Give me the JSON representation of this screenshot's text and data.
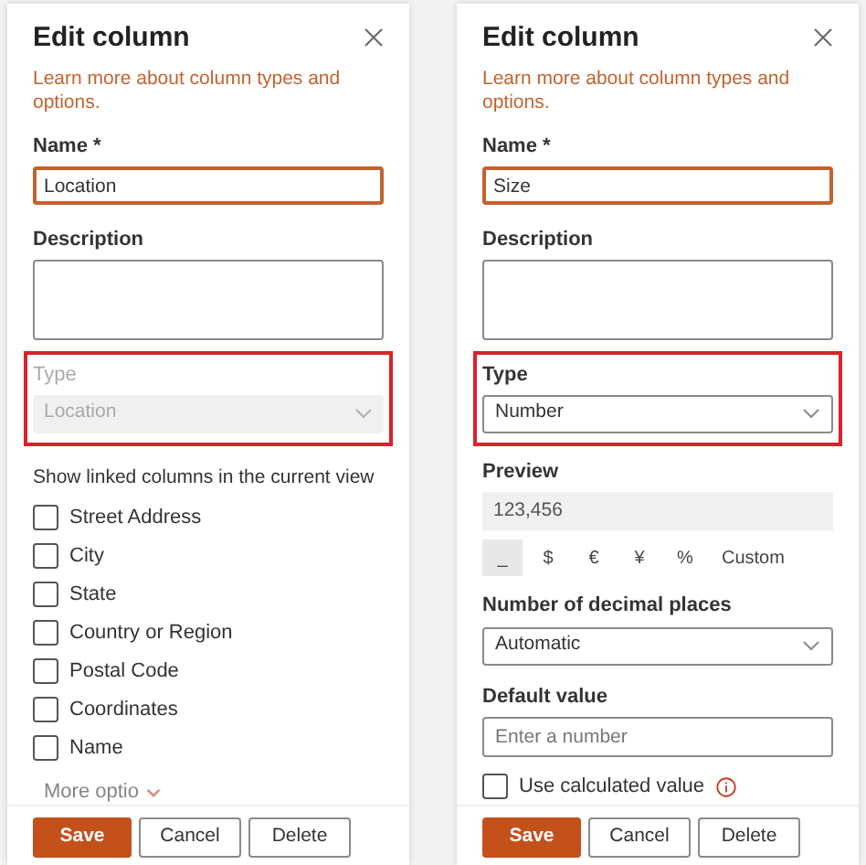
{
  "panels": [
    {
      "title": "Edit column",
      "link": "Learn more about column types and options.",
      "name_field": {
        "label": "Name *",
        "value": "Location"
      },
      "description_field": {
        "label": "Description"
      },
      "type_field": {
        "label": "Type",
        "value": "Location",
        "disabled": true
      },
      "sections": [
        {
          "kind": "checklist",
          "label": "Show linked columns in the current view",
          "items": [
            {
              "label": "Street Address",
              "checked": false
            },
            {
              "label": "City",
              "checked": false
            },
            {
              "label": "State",
              "checked": false
            },
            {
              "label": "Country or Region",
              "checked": false
            },
            {
              "label": "Postal Code",
              "checked": false
            },
            {
              "label": "Coordinates",
              "checked": false
            },
            {
              "label": "Name",
              "checked": false
            }
          ]
        },
        {
          "kind": "more",
          "label": "More optio"
        }
      ],
      "buttons": [
        "Save",
        "Cancel",
        "Delete"
      ]
    },
    {
      "title": "Edit column",
      "link": "Learn more about column types and options.",
      "name_field": {
        "label": "Name *",
        "value": "Size"
      },
      "description_field": {
        "label": "Description"
      },
      "type_field": {
        "label": "Type",
        "value": "Number",
        "disabled": false
      },
      "sections": [
        {
          "kind": "preview",
          "label": "Preview",
          "value": "123,456",
          "formats": [
            {
              "label": "_",
              "selected": true
            },
            {
              "label": "$",
              "selected": false
            },
            {
              "label": "€",
              "selected": false
            },
            {
              "label": "¥",
              "selected": false
            },
            {
              "label": "%",
              "selected": false
            },
            {
              "label": "Custom",
              "selected": false
            }
          ]
        },
        {
          "kind": "select",
          "label": "Number of decimal places",
          "value": "Automatic"
        },
        {
          "kind": "input",
          "label": "Default value",
          "placeholder": "Enter a number"
        },
        {
          "kind": "checkbox",
          "label": "Use calculated value",
          "checked": false
        }
      ],
      "buttons": [
        "Save",
        "Cancel",
        "Delete"
      ]
    }
  ]
}
